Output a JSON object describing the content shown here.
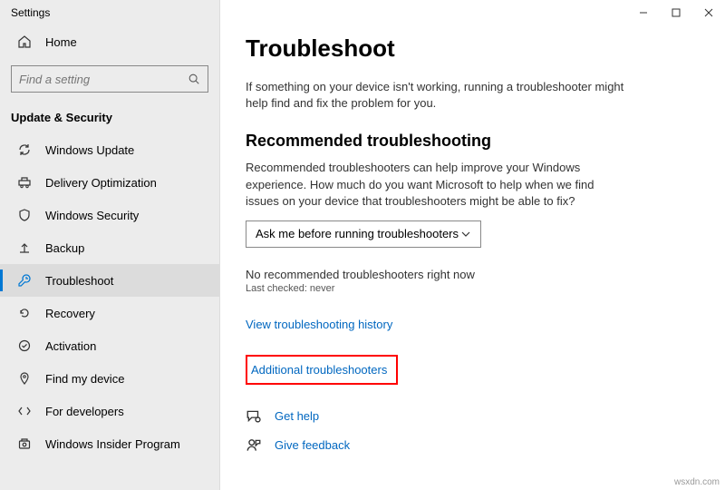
{
  "window": {
    "title": "Settings"
  },
  "sidebar": {
    "home": "Home",
    "search_placeholder": "Find a setting",
    "section": "Update & Security",
    "items": [
      {
        "label": "Windows Update"
      },
      {
        "label": "Delivery Optimization"
      },
      {
        "label": "Windows Security"
      },
      {
        "label": "Backup"
      },
      {
        "label": "Troubleshoot"
      },
      {
        "label": "Recovery"
      },
      {
        "label": "Activation"
      },
      {
        "label": "Find my device"
      },
      {
        "label": "For developers"
      },
      {
        "label": "Windows Insider Program"
      }
    ]
  },
  "main": {
    "heading": "Troubleshoot",
    "intro": "If something on your device isn't working, running a troubleshooter might help find and fix the problem for you.",
    "section_heading": "Recommended troubleshooting",
    "section_desc": "Recommended troubleshooters can help improve your Windows experience. How much do you want Microsoft to help when we find issues on your device that troubleshooters might be able to fix?",
    "dropdown_value": "Ask me before running troubleshooters",
    "status": "No recommended troubleshooters right now",
    "last_checked": "Last checked: never",
    "history_link": "View troubleshooting history",
    "additional_link": "Additional troubleshooters",
    "get_help": "Get help",
    "give_feedback": "Give feedback"
  },
  "watermark": "wsxdn.com"
}
